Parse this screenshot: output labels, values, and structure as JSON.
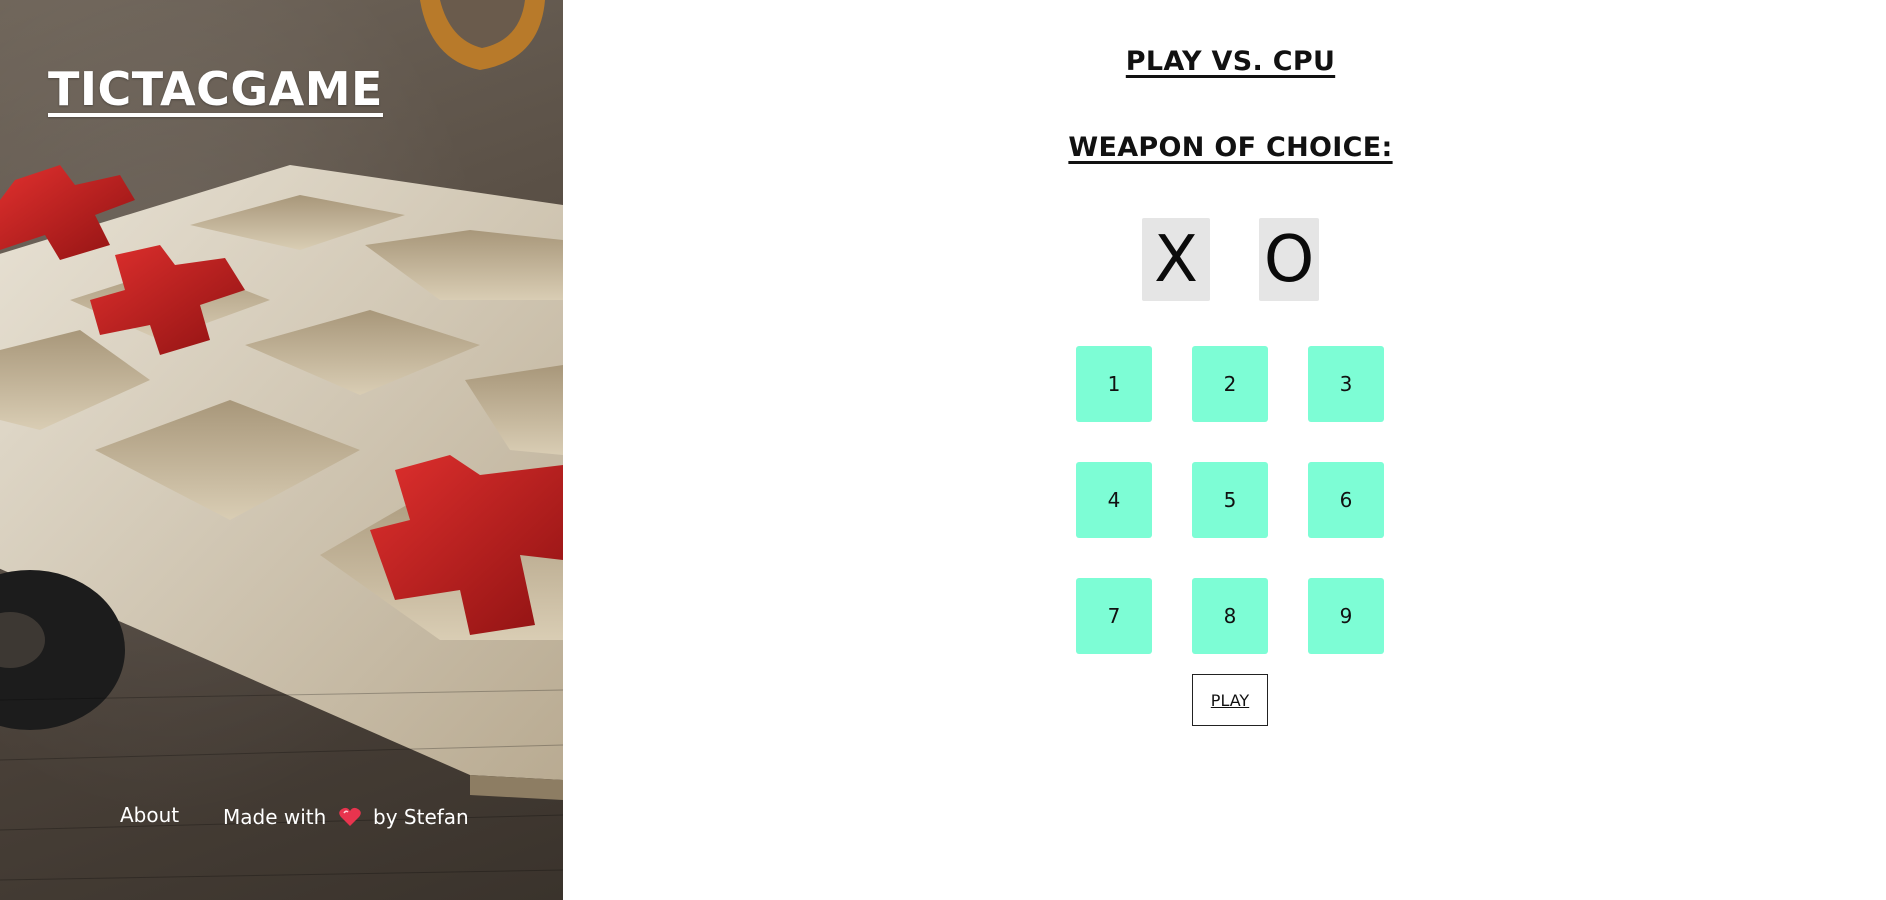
{
  "brand": {
    "title": "TICTACGAME"
  },
  "footer": {
    "about_label": "About",
    "made_prefix": "Made with",
    "made_suffix": "by Stefan",
    "heart_icon": "heart-icon"
  },
  "game": {
    "mode_title": "PLAY VS. CPU",
    "weapon_title": "WEAPON OF CHOICE:",
    "weapons": [
      "X",
      "O"
    ],
    "cells": [
      "1",
      "2",
      "3",
      "4",
      "5",
      "6",
      "7",
      "8",
      "9"
    ],
    "play_label": "PLAY"
  },
  "colors": {
    "cell": "#7dfdd5",
    "weapon_bg": "#e5e5e5",
    "piece_red": "#c81e1e",
    "heart": "#e8344e"
  }
}
